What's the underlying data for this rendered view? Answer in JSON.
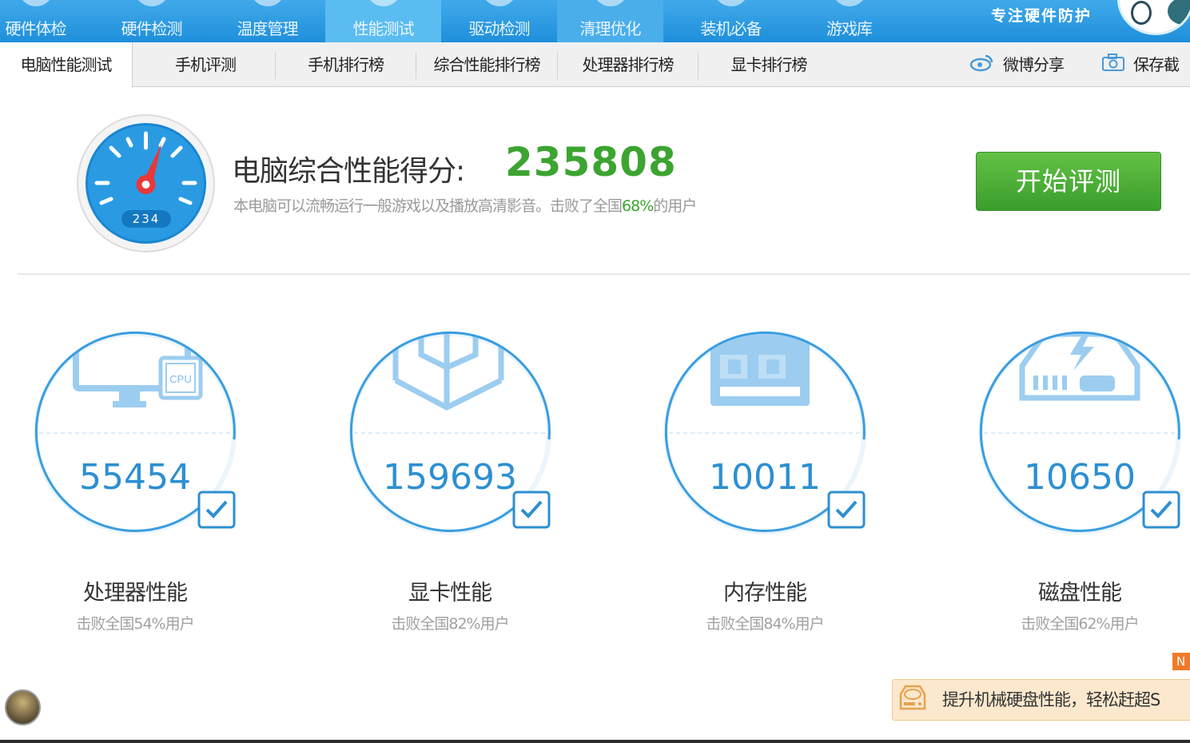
{
  "top_nav": {
    "tabs": [
      {
        "label": "硬件体检",
        "icon": "monitor-icon"
      },
      {
        "label": "硬件检测",
        "icon": "chip-icon"
      },
      {
        "label": "温度管理",
        "icon": "thermometer-icon"
      },
      {
        "label": "性能测试",
        "icon": "gauge-icon",
        "active": true
      },
      {
        "label": "驱动检测",
        "icon": "driver-icon"
      },
      {
        "label": "清理优化",
        "icon": "broom-icon"
      },
      {
        "label": "装机必备",
        "icon": "box-icon"
      },
      {
        "label": "游戏库",
        "icon": "gamepad-icon"
      }
    ],
    "slogan": "专注硬件防护"
  },
  "sub_nav": {
    "tabs": [
      "电脑性能测试",
      "手机评测",
      "手机排行榜",
      "综合性能排行榜",
      "处理器排行榜",
      "显卡排行榜"
    ],
    "weibo_share": "微博分享",
    "save_screenshot": "保存截"
  },
  "score": {
    "gauge_readout": "234",
    "label": "电脑综合性能得分:",
    "value": "235808",
    "desc_before": "本电脑可以流畅运行一般游戏以及播放高清影音。击败了全国",
    "desc_pct": "68%",
    "desc_after": "的用户",
    "start_button": "开始评测"
  },
  "cards": [
    {
      "score": "55454",
      "title": "处理器性能",
      "sub": "击败全国54%用户",
      "icon": "cpu-monitor-icon",
      "checked": true,
      "chip_text": "CPU"
    },
    {
      "score": "159693",
      "title": "显卡性能",
      "sub": "击败全国82%用户",
      "icon": "graphics-cube-icon",
      "checked": true
    },
    {
      "score": "10011",
      "title": "内存性能",
      "sub": "击败全国84%用户",
      "icon": "memory-chip-icon",
      "checked": true
    },
    {
      "score": "10650",
      "title": "磁盘性能",
      "sub": "击败全国62%用户",
      "icon": "hard-disk-icon",
      "checked": true
    }
  ],
  "bottom": {
    "new_badge": "N",
    "promo_text": "提升机械硬盘性能，轻松赶超S"
  },
  "colors": {
    "nav_blue": "#2b9ae0",
    "score_green": "#3ca431",
    "card_blue": "#2d8fd1",
    "button_green": "#4caf38"
  }
}
